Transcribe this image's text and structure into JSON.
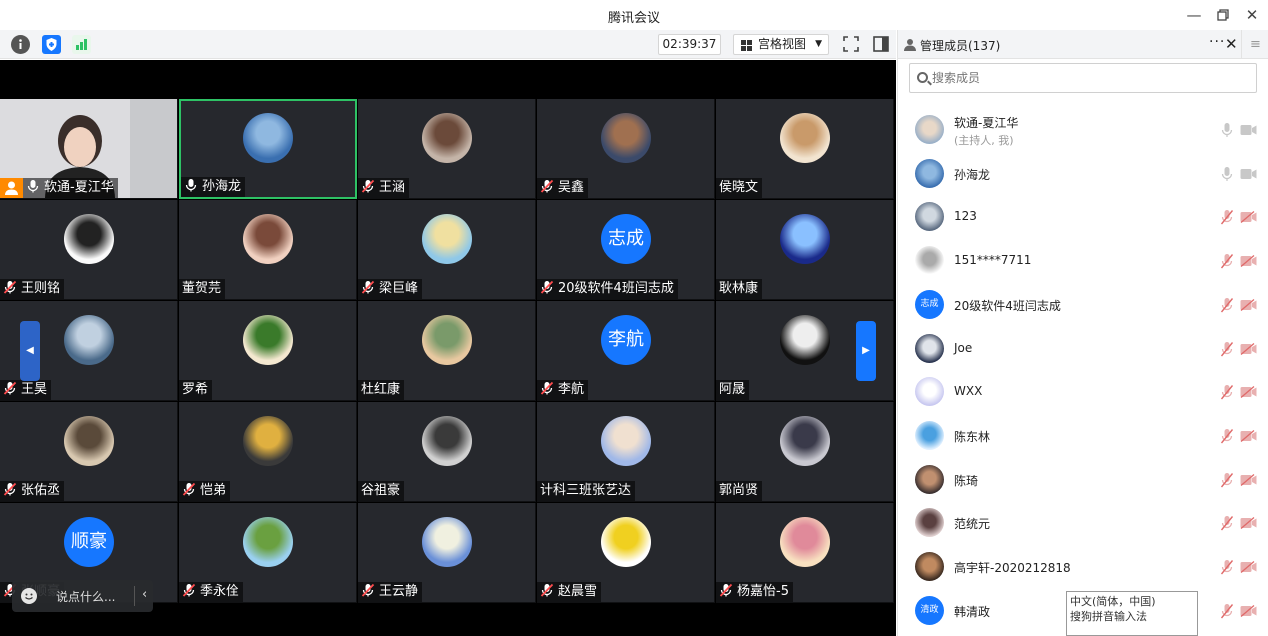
{
  "window": {
    "title": "腾讯会议",
    "controls": [
      "minimize-icon",
      "restore-icon",
      "close-icon"
    ]
  },
  "toolbar": {
    "timer": "02:39:37",
    "view_label": "宫格视图"
  },
  "tiles": [
    {
      "name": "软通-夏江华",
      "mic": "on",
      "avatar": "video",
      "host": true
    },
    {
      "name": "孙海龙",
      "mic": "on",
      "avatar": "photo",
      "active": true
    },
    {
      "name": "王涵",
      "mic": "muted",
      "avatar": "photo"
    },
    {
      "name": "吴鑫",
      "mic": "muted",
      "avatar": "photo"
    },
    {
      "name": "侯晓文",
      "mic": "none",
      "avatar": "photo"
    },
    {
      "name": "王则铭",
      "mic": "muted",
      "avatar": "photo"
    },
    {
      "name": "董贺芫",
      "mic": "none",
      "avatar": "photo"
    },
    {
      "name": "梁巨峰",
      "mic": "muted",
      "avatar": "photo"
    },
    {
      "name": "20级软件4班闫志成",
      "mic": "muted",
      "avatar": "text",
      "avatar_text": "志成"
    },
    {
      "name": "耿林康",
      "mic": "none",
      "avatar": "photo"
    },
    {
      "name": "王昊",
      "mic": "muted",
      "avatar": "photo"
    },
    {
      "name": "罗希",
      "mic": "none",
      "avatar": "photo"
    },
    {
      "name": "杜红康",
      "mic": "none",
      "avatar": "photo"
    },
    {
      "name": "李航",
      "mic": "muted",
      "avatar": "text",
      "avatar_text": "李航"
    },
    {
      "name": "阿晟",
      "mic": "none",
      "avatar": "photo"
    },
    {
      "name": "张佑丞",
      "mic": "muted",
      "avatar": "photo"
    },
    {
      "name": "恺弟",
      "mic": "muted",
      "avatar": "photo"
    },
    {
      "name": "谷祖豪",
      "mic": "none",
      "avatar": "photo"
    },
    {
      "name": "计科三班张艺达",
      "mic": "none",
      "avatar": "photo"
    },
    {
      "name": "郭尚贤",
      "mic": "none",
      "avatar": "photo"
    },
    {
      "name": "张顺豪",
      "mic": "muted",
      "avatar": "text",
      "avatar_text": "顺豪"
    },
    {
      "name": "季永佺",
      "mic": "muted",
      "avatar": "photo"
    },
    {
      "name": "王云静",
      "mic": "muted",
      "avatar": "photo"
    },
    {
      "name": "赵晨雪",
      "mic": "muted",
      "avatar": "photo"
    },
    {
      "name": "杨嘉怡-5",
      "mic": "muted",
      "avatar": "photo"
    }
  ],
  "chat": {
    "placeholder": "说点什么..."
  },
  "panel": {
    "title": "管理成员(137)",
    "search_placeholder": "搜索成员",
    "members": [
      {
        "name": "软通-夏江华",
        "sub": "(主持人, 我)",
        "mic": "on",
        "avatar": "photo"
      },
      {
        "name": "孙海龙",
        "mic": "on",
        "avatar": "photo"
      },
      {
        "name": "123",
        "mic": "muted",
        "avatar": "photo"
      },
      {
        "name": "151****7711",
        "mic": "muted",
        "avatar": "photo"
      },
      {
        "name": "20级软件4班闫志成",
        "mic": "muted",
        "avatar": "text",
        "avatar_text": "志成"
      },
      {
        "name": "Joe",
        "mic": "muted",
        "avatar": "photo"
      },
      {
        "name": "WXX",
        "mic": "muted",
        "avatar": "photo"
      },
      {
        "name": "陈东林",
        "mic": "muted",
        "avatar": "photo"
      },
      {
        "name": "陈琦",
        "mic": "muted",
        "avatar": "photo"
      },
      {
        "name": "范统元",
        "mic": "muted",
        "avatar": "photo"
      },
      {
        "name": "高宇轩-2020212818",
        "mic": "muted",
        "avatar": "photo"
      },
      {
        "name": "韩清政",
        "mic": "muted",
        "avatar": "text",
        "avatar_text": "清政"
      }
    ]
  },
  "ime": {
    "line1": "中文(简体，中国)",
    "line2": "搜狗拼音输入法"
  },
  "colors": {
    "accent": "#1677ff",
    "active_border": "#2ec265",
    "host_badge": "#ff8a00",
    "tile_bg": "#26282d",
    "muted_red": "#e04040"
  }
}
